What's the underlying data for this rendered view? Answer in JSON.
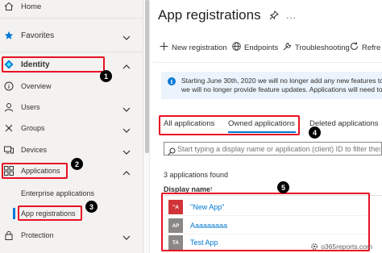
{
  "sidebar": {
    "home": "Home",
    "favorites": "Favorites",
    "identity": "Identity",
    "overview": "Overview",
    "users": "Users",
    "groups": "Groups",
    "devices": "Devices",
    "applications": "Applications",
    "enterprise_applications": "Enterprise applications",
    "app_registrations": "App registrations",
    "protection": "Protection"
  },
  "header": {
    "title": "App registrations",
    "more": "..."
  },
  "toolbar": {
    "new_registration": "New registration",
    "endpoints": "Endpoints",
    "troubleshooting": "Troubleshooting",
    "refresh": "Refre"
  },
  "info": {
    "line1": "Starting June 30th, 2020 we will no longer add any new features to Azu",
    "line2": "we will no longer provide feature updates. Applications will need to be"
  },
  "tabs": {
    "all": "All applications",
    "owned": "Owned applications",
    "deleted": "Deleted applications"
  },
  "search": {
    "placeholder": "Start typing a display name or application (client) ID to filter these r"
  },
  "list": {
    "count": "3 applications found",
    "column_display_name": "Display name",
    "sort_arrow": "↑",
    "rows": [
      {
        "initials": "\"A",
        "name": "\"New App\"",
        "color": "#d13438"
      },
      {
        "initials": "AP",
        "name": "Aaaaaaaaa",
        "color": "#8a8886"
      },
      {
        "initials": "TA",
        "name": "Test App",
        "color": "#8a8886"
      }
    ]
  },
  "callouts": [
    "1",
    "2",
    "3",
    "4",
    "5"
  ],
  "watermark": "o365reports.com",
  "colors": {
    "accent": "#0078d4",
    "callout_red": "#e81123"
  }
}
